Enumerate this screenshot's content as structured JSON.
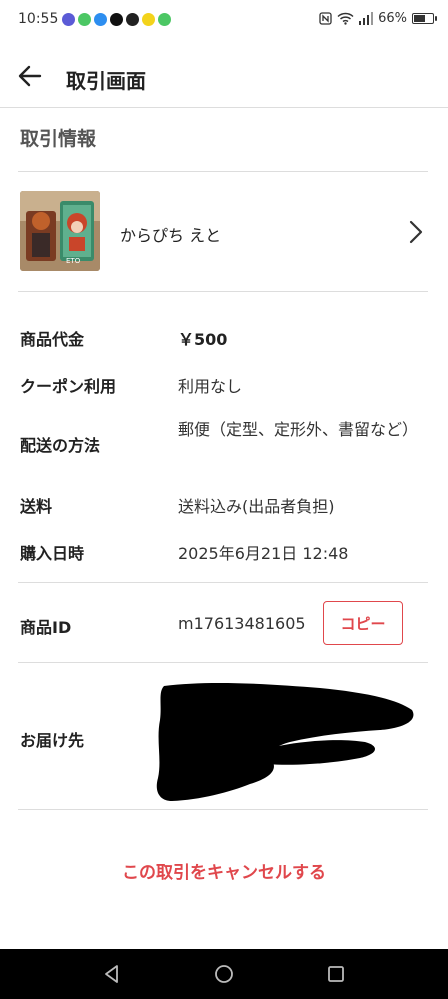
{
  "status_bar": {
    "time": "10:55",
    "battery_text": "66%",
    "battery_level": 0.66,
    "app_icons": [
      {
        "name": "messenger-app-icon",
        "color": "#5b5bd6"
      },
      {
        "name": "line-green-app-icon",
        "color": "#4cc764"
      },
      {
        "name": "blue-app-icon",
        "color": "#2d8ef0"
      },
      {
        "name": "tiktok-app-icon",
        "color": "#111111"
      },
      {
        "name": "black-app-icon",
        "color": "#222222"
      },
      {
        "name": "yellow-app-icon",
        "color": "#f3d31b"
      },
      {
        "name": "line-app-icon",
        "color": "#4cc764"
      }
    ]
  },
  "header": {
    "title": "取引画面"
  },
  "section": {
    "title": "取引情報"
  },
  "item": {
    "name": "からぴち えと"
  },
  "details": {
    "price_label": "商品代金",
    "price_value": "￥500",
    "coupon_label": "クーポン利用",
    "coupon_value": "利用なし",
    "shipping_method_label": "配送の方法",
    "shipping_method_value": "郵便（定型、定形外、書留など）",
    "shipping_fee_label": "送料",
    "shipping_fee_value": "送料込み(出品者負担)",
    "purchase_date_label": "購入日時",
    "purchase_date_value": "2025年6月21日 12:48",
    "item_id_label": "商品ID",
    "item_id_value": "m17613481605",
    "copy_label": "コピー",
    "address_label": "お届け先"
  },
  "actions": {
    "cancel_label": "この取引をキャンセルする"
  },
  "colors": {
    "accent": "#e0474c",
    "divider": "#dddddd",
    "nav_bar": "#000000"
  }
}
